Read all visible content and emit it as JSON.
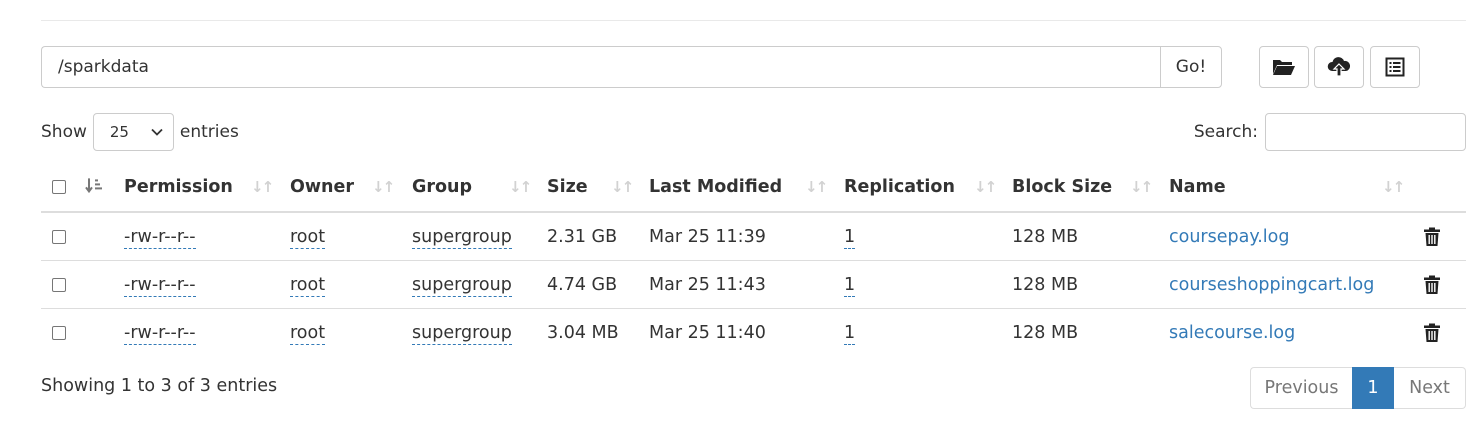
{
  "path_bar": {
    "value": "/sparkdata",
    "go_label": "Go!"
  },
  "toolbar": {
    "create_dir_icon": "folder-open-icon",
    "upload_icon": "cloud-upload-icon",
    "cut_icon": "list-alt-icon"
  },
  "controls": {
    "show_label": "Show",
    "entries_value": "25",
    "entries_label": "entries",
    "search_label": "Search:",
    "search_value": ""
  },
  "table": {
    "columns": [
      "Permission",
      "Owner",
      "Group",
      "Size",
      "Last Modified",
      "Replication",
      "Block Size",
      "Name"
    ],
    "rows": [
      {
        "permission": "-rw-r--r--",
        "owner": "root",
        "group": "supergroup",
        "size": "2.31 GB",
        "modified": "Mar 25 11:39",
        "replication": "1",
        "block_size": "128 MB",
        "name": "coursepay.log"
      },
      {
        "permission": "-rw-r--r--",
        "owner": "root",
        "group": "supergroup",
        "size": "4.74 GB",
        "modified": "Mar 25 11:43",
        "replication": "1",
        "block_size": "128 MB",
        "name": "courseshoppingcart.log"
      },
      {
        "permission": "-rw-r--r--",
        "owner": "root",
        "group": "supergroup",
        "size": "3.04 MB",
        "modified": "Mar 25 11:40",
        "replication": "1",
        "block_size": "128 MB",
        "name": "salecourse.log"
      }
    ]
  },
  "footer": {
    "info": "Showing 1 to 3 of 3 entries",
    "previous": "Previous",
    "current_page": "1",
    "next": "Next"
  },
  "colors": {
    "link": "#337ab7",
    "active_page": "#337ab7",
    "border": "#dddddd"
  }
}
